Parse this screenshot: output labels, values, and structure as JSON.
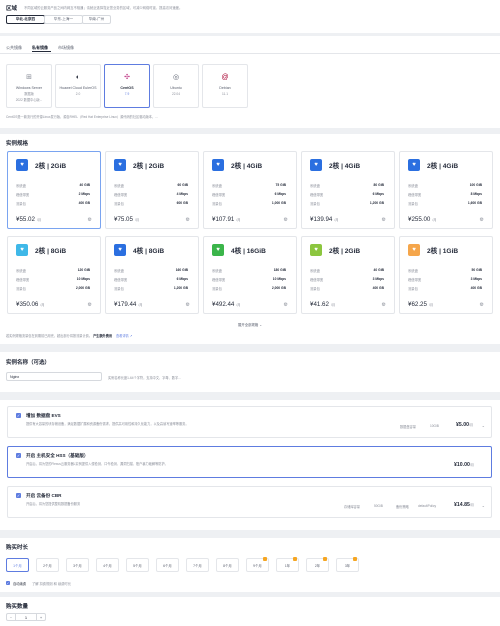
{
  "region": {
    "title": "区域",
    "note": "不同区域的云服务产品之间内网互不相通；请就近选择靠近您业务的区域，可减少网络时延、提高访问速度。",
    "options": [
      "华北-北京四",
      "华东-上海一",
      "华南-广州"
    ],
    "selected_index": 0
  },
  "image": {
    "tabs": [
      "公共镜像",
      "私有镜像",
      "市场镜像"
    ],
    "selected_tab": 1,
    "os": [
      {
        "name": "Windows Server",
        "sub": "数据版",
        "version": "2022 数据中心版...",
        "icon": "windows-icon",
        "color": "#8a8e99"
      },
      {
        "name": "Huawei Cloud EulerOS",
        "version": "2.0",
        "icon": "euleros-icon",
        "color": "#252b3a"
      },
      {
        "name": "CentOS",
        "version": "7.9",
        "icon": "centos-icon",
        "color": "#c23e8a"
      },
      {
        "name": "Ubuntu",
        "version": "22.04",
        "icon": "ubuntu-icon",
        "color": "#575d6c"
      },
      {
        "name": "Debian",
        "version": "11.1",
        "icon": "debian-icon",
        "color": "#a80030"
      }
    ],
    "selected_os": 2,
    "note": "CentOS是一款流行的开源Linux发行版，源自RHEL（Red Hat Enterprise Linux）源代码的社区驱动版本，..."
  },
  "specs": {
    "title": "实例规格",
    "labels": {
      "cpu": "系统盘",
      "bandwidth": "峰值带宽",
      "traffic": "流量包",
      "unit": "/月"
    },
    "items": [
      {
        "name": "2核 | 2GiB",
        "disk": "40 GiB",
        "bw": "2 Mbps",
        "traffic": "400 GB",
        "price": "¥55.02",
        "color": "#2b6fe0"
      },
      {
        "name": "2核 | 2GiB",
        "disk": "60 GiB",
        "bw": "4 Mbps",
        "traffic": "600 GB",
        "price": "¥75.05",
        "color": "#2b6fe0"
      },
      {
        "name": "2核 | 4GiB",
        "disk": "75 GiB",
        "bw": "6 Mbps",
        "traffic": "1,000 GB",
        "price": "¥107.91",
        "color": "#2b6fe0"
      },
      {
        "name": "2核 | 4GiB",
        "disk": "80 GiB",
        "bw": "6 Mbps",
        "traffic": "1,200 GB",
        "price": "¥139.94",
        "color": "#2b6fe0"
      },
      {
        "name": "2核 | 4GiB",
        "disk": "100 GiB",
        "bw": "8 Mbps",
        "traffic": "1,600 GB",
        "price": "¥255.00",
        "color": "#2b6fe0"
      },
      {
        "name": "2核 | 8GiB",
        "disk": "120 GiB",
        "bw": "10 Mbps",
        "traffic": "2,000 GB",
        "price": "¥350.06",
        "color": "#3fb8e8"
      },
      {
        "name": "4核 | 8GiB",
        "disk": "160 GiB",
        "bw": "6 Mbps",
        "traffic": "1,200 GB",
        "price": "¥179.44",
        "color": "#2b6fe0"
      },
      {
        "name": "4核 | 16GiB",
        "disk": "180 GiB",
        "bw": "10 Mbps",
        "traffic": "2,000 GB",
        "price": "¥492.44",
        "color": "#3bb54a"
      },
      {
        "name": "2核 | 2GiB",
        "disk": "40 GiB",
        "bw": "3 Mbps",
        "traffic": "400 GB",
        "price": "¥41.62",
        "color": "#8cc63f"
      },
      {
        "name": "2核 | 1GiB",
        "disk": "50 GiB",
        "bw": "3 Mbps",
        "traffic": "400 GB",
        "price": "¥62.25",
        "color": "#f5a64b"
      }
    ],
    "selected_index": 0,
    "expand": "展开全部规格",
    "footer": "若实例规格流量包在到期前已用完，超出部分将按流量计费。",
    "footer_bold": "产生额外费用",
    "footer_link": "查看详情"
  },
  "name": {
    "title": "实例名称（可选）",
    "value": "Nginx",
    "hint": "实例名称长度1-64个字符，支持中文、字母、数字..."
  },
  "addons": [
    {
      "title": "增加 数据盘 EVS",
      "desc": "提供有大容量的块存储设备，满足数据扩展和资源备份需求，提供高可用性和持久化能力，以及高读写速率等服务。",
      "k1": "数据盘容量",
      "v1": "10GiB",
      "price": "¥5.00",
      "unit": "/月",
      "selected": false
    },
    {
      "title": "开启 主机安全 HSS（基础版）",
      "desc": "开启后，将为您的Flexus云服务器L实例提供入侵检测、口令检测、漏洞扫描、账户暴力破解等防护。",
      "price": "¥10.00",
      "unit": "/月",
      "selected": true
    },
    {
      "title": "开启 云备份 CBR",
      "desc": "开启后，将为您提供整机数据备份服务",
      "k1": "存储库容量",
      "v1": "50GiB",
      "k2": "备份策略",
      "v2": "defaultPolicy",
      "price": "¥14.85",
      "unit": "/月",
      "selected": false
    }
  ],
  "duration": {
    "title": "购买时长",
    "options": [
      "1个月",
      "2个月",
      "3个月",
      "4个月",
      "5个月",
      "6个月",
      "7个月",
      "8个月",
      "9个月",
      "1年",
      "2年",
      "3年"
    ],
    "badges": [
      false,
      false,
      false,
      false,
      false,
      false,
      false,
      false,
      true,
      true,
      true,
      true
    ],
    "selected_index": 0,
    "auto_renew": "自动续费",
    "auto_renew_link": "了解 扣费规则 和 续费时长"
  },
  "quantity": {
    "title": "购买数量",
    "value": "1",
    "minus": "−",
    "plus": "+"
  }
}
